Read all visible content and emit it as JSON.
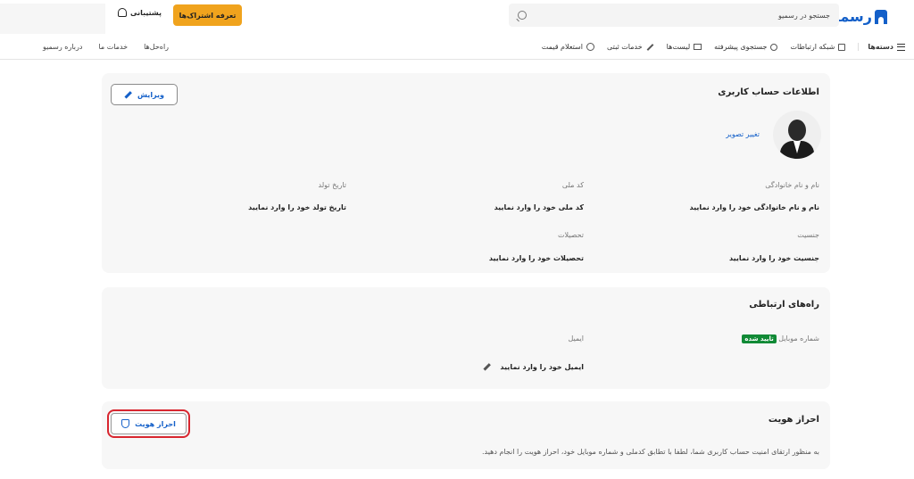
{
  "header": {
    "logo_text": "رسمیو",
    "search_placeholder": "جستجو در رسمیو",
    "subscribe_label": "تعرفه اشتراک‌ها",
    "support_label": "پشتیبانی"
  },
  "nav": {
    "categories": "دسته‌ها",
    "items": [
      {
        "label": "شبکه ارتباطات",
        "icon": "network-icon"
      },
      {
        "label": "جستجوی پیشرفته",
        "icon": "search-icon"
      },
      {
        "label": "لیست‌ها",
        "icon": "list-icon"
      },
      {
        "label": "خدمات ثبتی",
        "icon": "pen-icon"
      },
      {
        "label": "استعلام قیمت",
        "icon": "coin-icon"
      }
    ],
    "left_items": [
      "راه‌حل‌ها",
      "خدمات ما",
      "درباره رسمیو"
    ]
  },
  "account": {
    "title": "اطلاعات حساب کاربری",
    "edit_label": "ویرایش",
    "change_photo": "تغییر تصویر",
    "fields": {
      "name_label": "نام و نام خانوادگی",
      "name_value": "نام و نام خانوادگی خود را وارد نمایید",
      "national_code_label": "کد ملی",
      "national_code_value": "کد ملی خود را وارد نمایید",
      "birth_label": "تاریخ تولد",
      "birth_value": "تاریخ تولد خود را وارد نمایید",
      "gender_label": "جنسیت",
      "gender_value": "جنسیت خود را وارد نمایید",
      "education_label": "تحصیلات",
      "education_value": "تحصیلات خود را وارد نمایید"
    }
  },
  "contact": {
    "title": "راه‌های ارتباطی",
    "mobile_label": "شماره موبایل",
    "verified_badge": "تایید شده",
    "email_label": "ایمیل",
    "email_value": "ایمیل خود را وارد نمایید"
  },
  "identity": {
    "title": "احراز هویت",
    "button_label": "احراز هویت",
    "description": "به منظور ارتقای امنیت حساب کاربری شما، لطفا با تطابق کدملی و شماره موبایل خود، احراز هویت را انجام دهید."
  },
  "colors": {
    "brand": "#1460c9",
    "accent": "#f0a31d",
    "verified": "#118a36",
    "highlight": "#d8262f"
  }
}
